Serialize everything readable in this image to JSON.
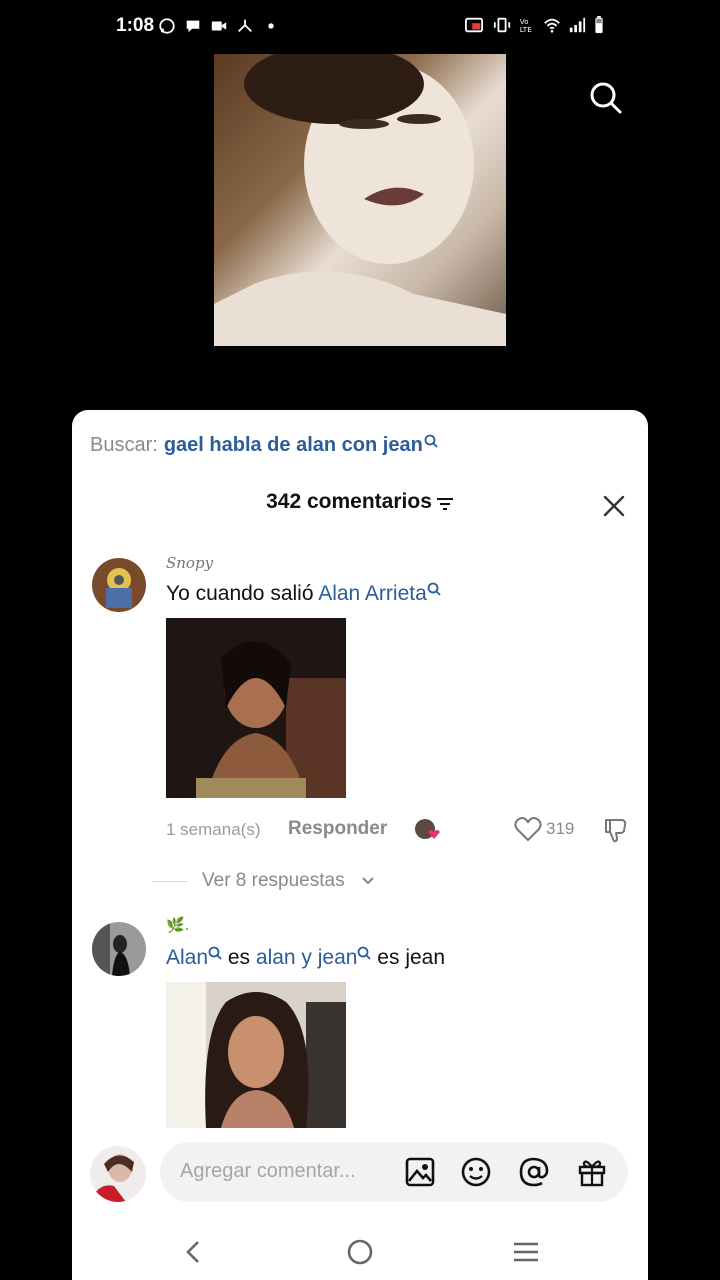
{
  "status_bar": {
    "time": "1:08",
    "left_icons": [
      "whatsapp-icon",
      "chat-icon",
      "video-icon",
      "share-icon",
      "dot-icon"
    ],
    "right_icons": [
      "cast-icon",
      "vibrate-icon",
      "volte-icon",
      "wifi-icon",
      "signal-icon",
      "battery-icon"
    ]
  },
  "video": {
    "search_icon": "search-icon"
  },
  "sheet": {
    "search_prefix": "Buscar:",
    "search_term": "gael habla de alan con jean",
    "title": "342 comentarios",
    "close_icon": "close-icon",
    "sort_icon": "sort-icon"
  },
  "comments": [
    {
      "username": "Snopy",
      "text_plain": "Yo cuando salió ",
      "text_link": "Alan Arrieta",
      "time": "1 semana(s)",
      "reply_label": "Responder",
      "like_count": "319",
      "replies_label": "Ver 8 respuestas"
    },
    {
      "username": "🌿.",
      "link_1": "Alan",
      "plain_1": " es ",
      "link_2": "alan y jean",
      "plain_2": " es jean"
    }
  ],
  "composer": {
    "placeholder": "Agregar comentar...",
    "icons": [
      "image-icon",
      "emoji-icon",
      "mention-icon",
      "gift-icon"
    ]
  },
  "navbar": {
    "icons": [
      "back-icon",
      "home-icon",
      "recents-icon"
    ]
  },
  "colors": {
    "link": "#2b5d9c",
    "background": "#000000",
    "sheet": "#ffffff",
    "like_heart": "#e8336a"
  }
}
